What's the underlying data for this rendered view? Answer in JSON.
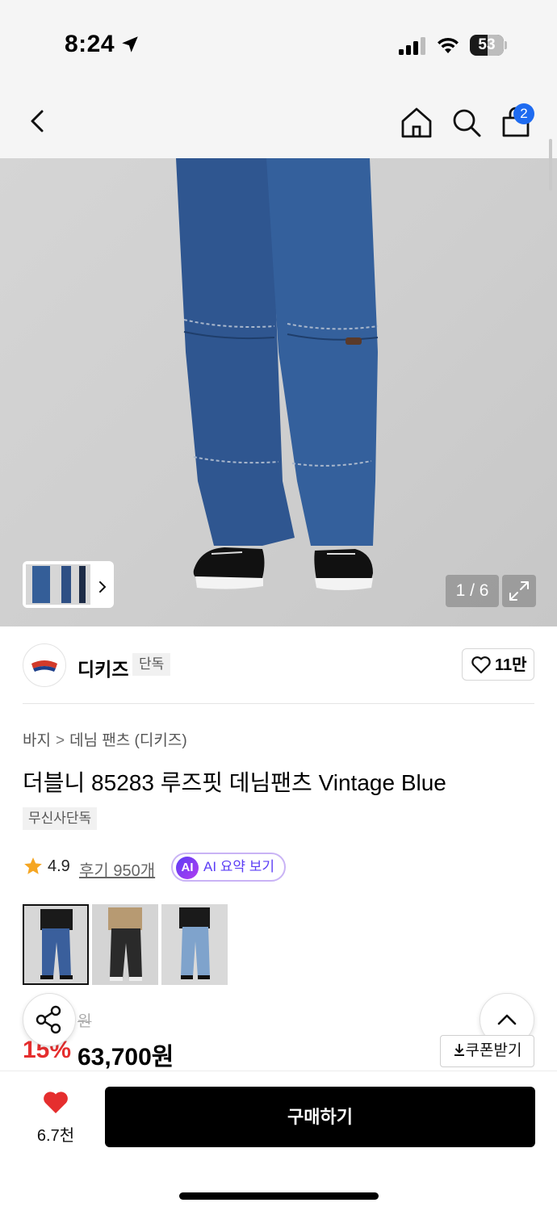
{
  "status_bar": {
    "time": "8:24",
    "battery": "53",
    "icons": [
      "location-arrow-icon",
      "signal-icon",
      "wifi-icon",
      "battery-icon"
    ]
  },
  "nav": {
    "icons": [
      "back-icon",
      "home-icon",
      "search-icon",
      "cart-icon"
    ],
    "cart_count": "2"
  },
  "gallery": {
    "counter": "1 / 6",
    "icons": [
      "chevron-right-icon",
      "expand-icon"
    ]
  },
  "brand": {
    "name": "디키즈",
    "tag": "단독",
    "likes": "11만"
  },
  "breadcrumb": {
    "category": "바지",
    "separator": ">",
    "subcategory": "데님 팬츠 (디키즈)"
  },
  "product": {
    "title": "더블니 85283 루즈핏 데님팬츠 Vintage Blue",
    "badge": "무신사단독"
  },
  "rating": {
    "value": "4.9",
    "reviews": "후기 950개",
    "ai_icon": "AI",
    "ai_label": "AI 요약 보기"
  },
  "colors": {
    "count": 3,
    "selected_index": 0,
    "swatches": [
      "#3a5f9c",
      "#2a2a2a",
      "#7fa3cc"
    ]
  },
  "price": {
    "original_partial": "원",
    "discount": "15%",
    "sale": "63,700원",
    "coupon": "쿠폰받기"
  },
  "bottom_bar": {
    "wish_count": "6.7천",
    "buy_label": "구매하기"
  },
  "colors_theme": {
    "accent_blue": "#1e6bf0",
    "discount_red": "#e52e2e",
    "heart_red": "#e52e2e",
    "ai_purple": "#5b3df5"
  }
}
